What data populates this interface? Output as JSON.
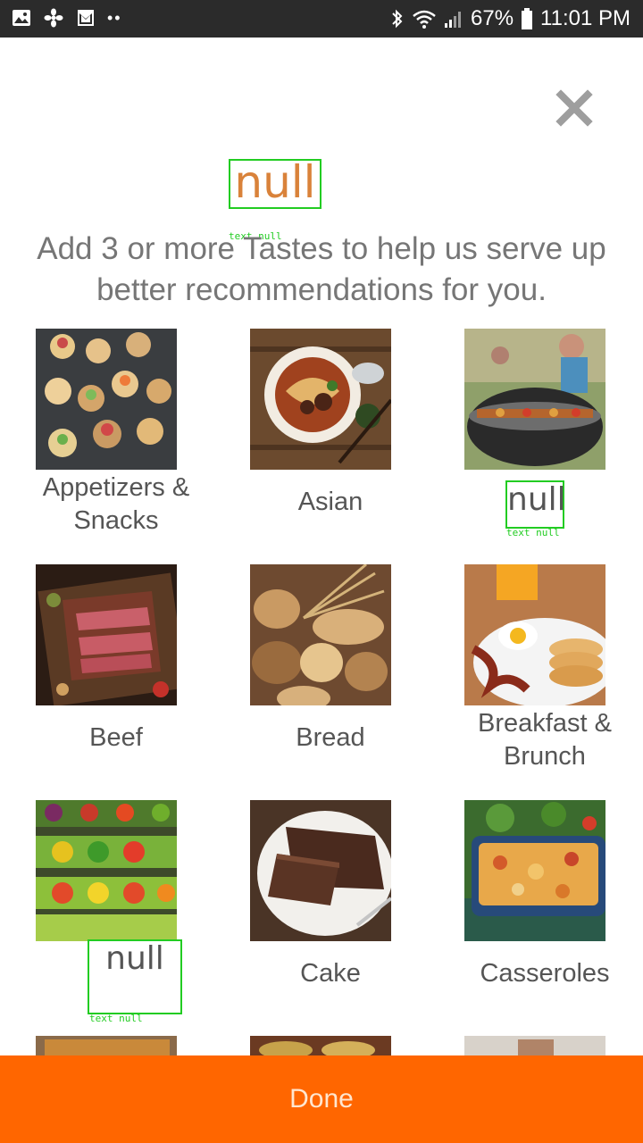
{
  "status_bar": {
    "battery": "67%",
    "time": "11:01 PM",
    "dots": "••"
  },
  "header": {
    "title": "null",
    "title_debug_tag": "text null",
    "instruction": "Add 3 or more Tastes to help us serve up better recommendations for you."
  },
  "tastes": [
    {
      "label": "Appetizers & Snacks"
    },
    {
      "label": "Asian"
    },
    {
      "label": "null",
      "debug_tag": "text null"
    },
    {
      "label": "Beef"
    },
    {
      "label": "Bread"
    },
    {
      "label": "Breakfast & Brunch"
    },
    {
      "label": "null",
      "debug_tag": "text null"
    },
    {
      "label": "Cake"
    },
    {
      "label": "Casseroles"
    }
  ],
  "footer": {
    "done_label": "Done"
  },
  "colors": {
    "accent": "#ff6600",
    "title_text": "#d9823a",
    "debug_outline": "#22cc22"
  }
}
